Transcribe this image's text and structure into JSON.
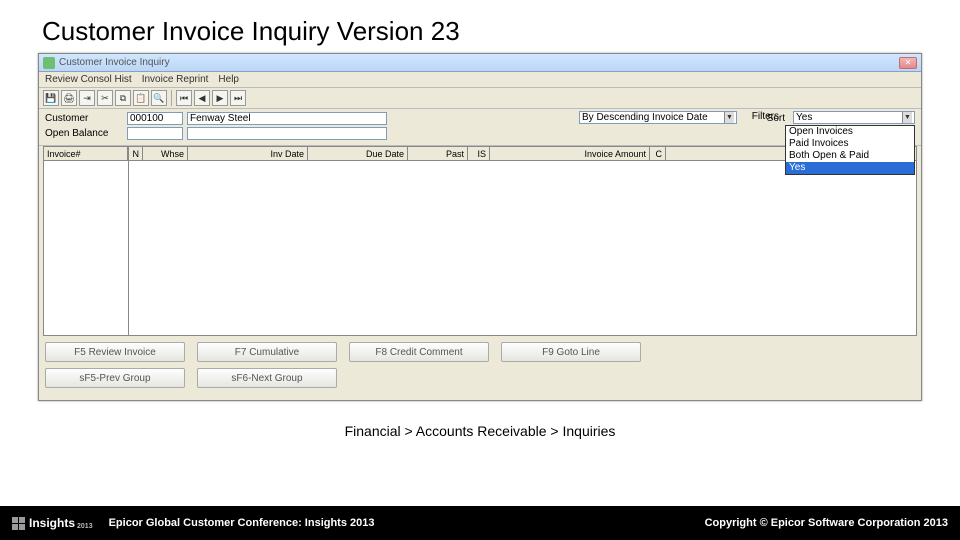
{
  "slide": {
    "title": "Customer Invoice Inquiry Version 23",
    "breadcrumb": "Financial > Accounts Receivable > Inquiries"
  },
  "window": {
    "title": "Customer Invoice Inquiry",
    "menus": [
      "Review Consol Hist",
      "Invoice Reprint",
      "Help"
    ]
  },
  "form": {
    "customer_label": "Customer",
    "customer_code": "000100",
    "customer_name": "Fenway Steel",
    "open_balance_label": "Open Balance",
    "sort_label": "Sort",
    "sort_value": "By Descending Invoice Date",
    "filters_label": "Filters",
    "filters_value": "Yes"
  },
  "filters_options": [
    "Open Invoices",
    "Paid Invoices",
    "Both Open & Paid",
    "Yes"
  ],
  "grid": {
    "left_headers": [
      "Invoice#"
    ],
    "right_headers": [
      "N",
      "Whse",
      "Inv Date",
      "Due Date",
      "Past",
      "IS",
      "Invoice Amount",
      "C"
    ]
  },
  "buttons": {
    "row1": [
      "F5 Review Invoice",
      "F7 Cumulative",
      "F8 Credit Comment",
      "F9 Goto Line"
    ],
    "row2": [
      "sF5-Prev Group",
      "sF6-Next Group"
    ]
  },
  "footer": {
    "logo": "Insights",
    "year": "2013",
    "left": "Epicor Global Customer Conference: Insights 2013",
    "right": "Copyright © Epicor Software Corporation 2013"
  }
}
